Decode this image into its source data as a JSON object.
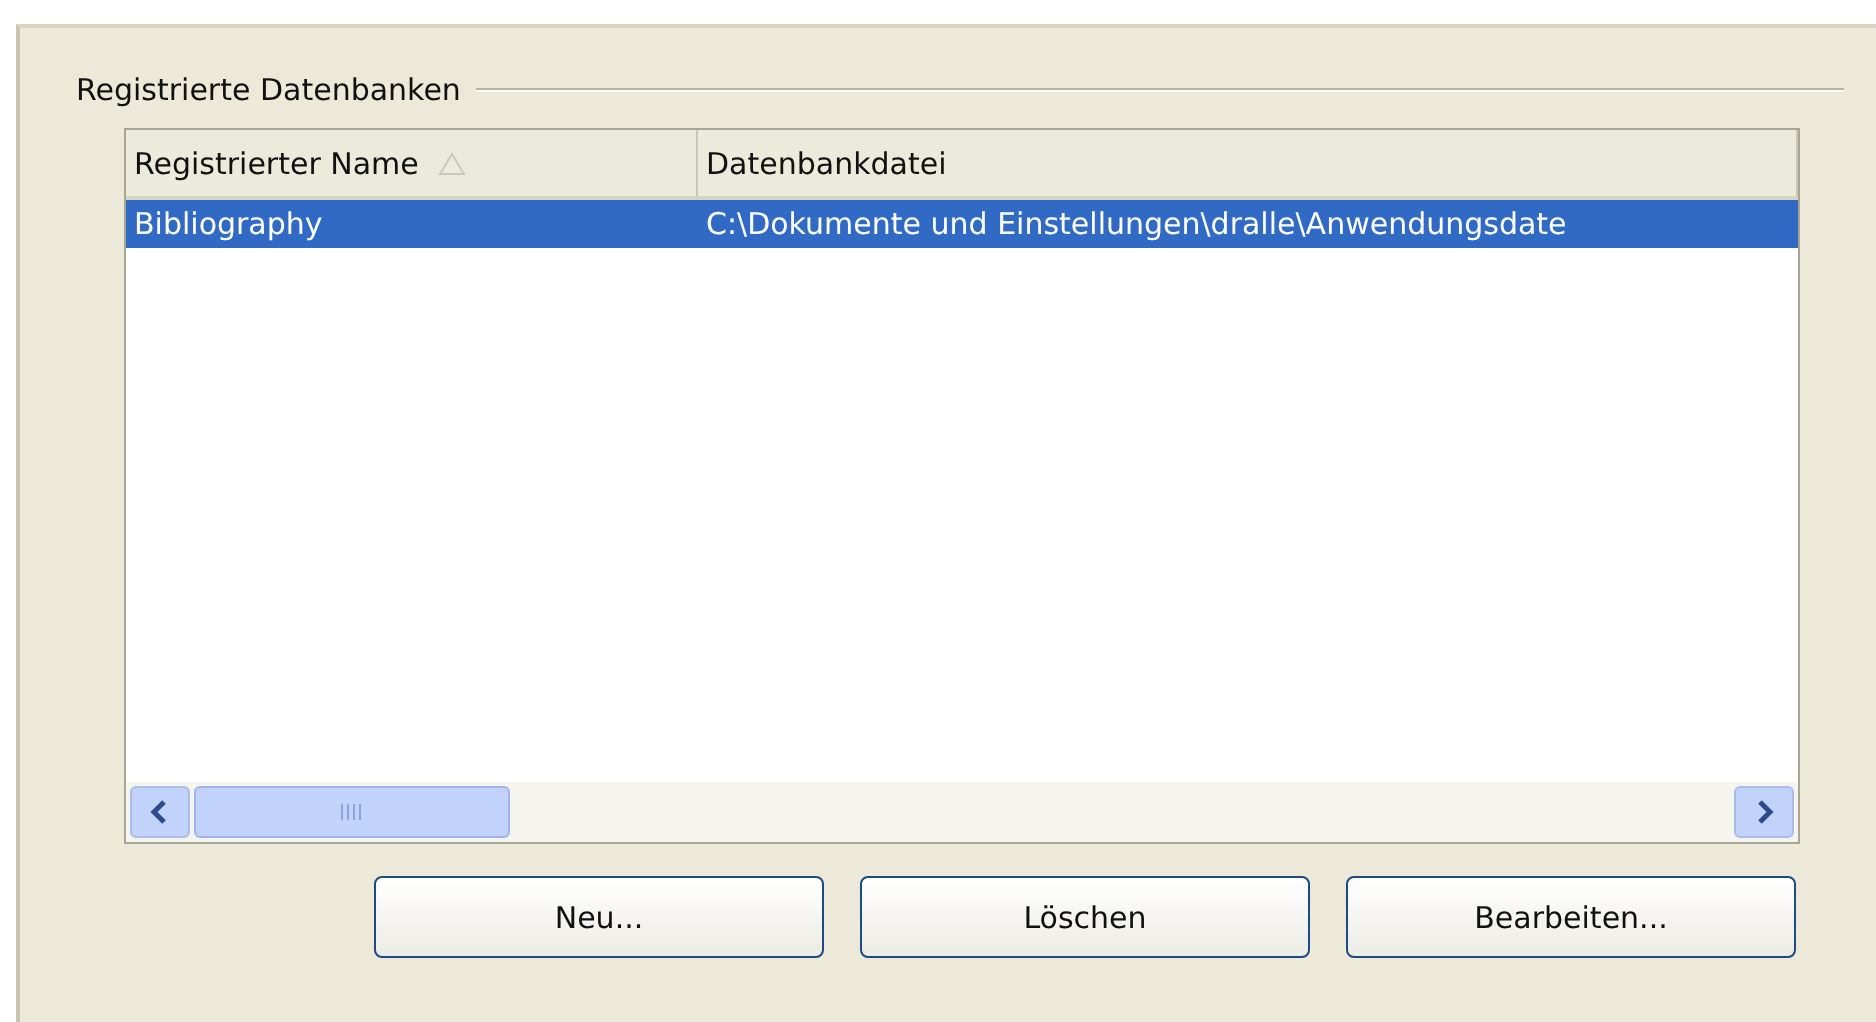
{
  "group": {
    "title": "Registrierte Datenbanken"
  },
  "table": {
    "columns": [
      {
        "label": "Registrierter Name",
        "sorted": true
      },
      {
        "label": "Datenbankdatei",
        "sorted": false
      }
    ],
    "rows": [
      {
        "cells": [
          "Bibliography",
          "C:\\Dokumente und Einstellungen\\dralle\\Anwendungsdate"
        ],
        "selected": true
      }
    ]
  },
  "buttons": [
    "Neu...",
    "Löschen",
    "Bearbeiten..."
  ]
}
